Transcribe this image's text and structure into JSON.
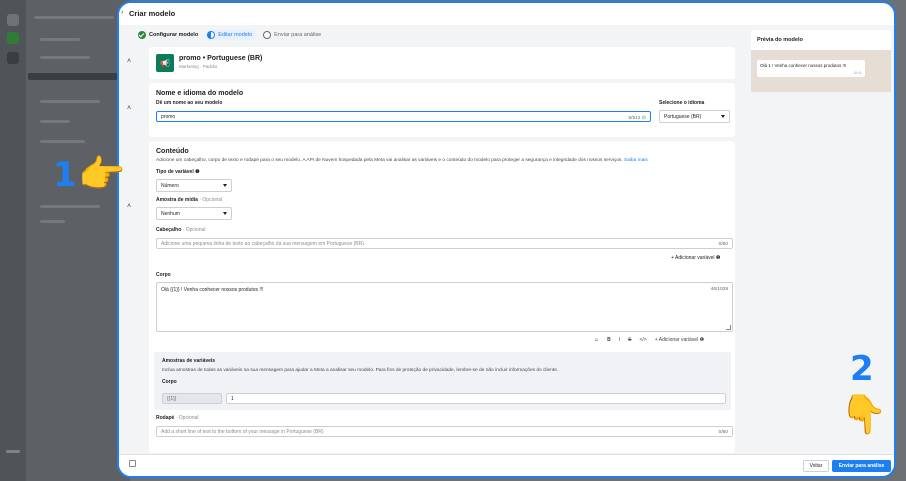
{
  "header": {
    "back_glyph": "›",
    "title": "Criar modelo"
  },
  "steps": [
    {
      "label": "Configurar modelo",
      "state": "done"
    },
    {
      "label": "Editar modelo",
      "state": "active"
    },
    {
      "label": "Enviar para análise",
      "state": "todo"
    }
  ],
  "template": {
    "icon": "megaphone-icon",
    "name": "promo • Portuguese (BR)",
    "subtitle": "Marketing · Padrão"
  },
  "name_section": {
    "title": "Nome e idioma do modelo",
    "name_label": "Dê um nome ao seu modelo",
    "name_value": "promo",
    "name_counter": "5/512",
    "lang_label": "Selecione o idioma",
    "lang_value": "Portuguese (BR)"
  },
  "content": {
    "title": "Conteúdo",
    "description": "Adicione um cabeçalho, corpo de texto e rodapé para o seu modelo. A API de Nuvem hospedada pela Meta vai analisar as variáveis e o conteúdo do modelo para proteger a segurança e integridade dos nossos serviços.",
    "learn_more": "Saiba mais",
    "var_type_label": "Tipo de variável",
    "var_type_value": "Número",
    "media_label": "Amostra de mídia",
    "optional": "· Opcional",
    "media_value": "Nenhum",
    "header_label": "Cabeçalho",
    "header_placeholder": "Adicione uma pequena linha de texto ao cabeçalho da sua mensagem em Portuguese (BR)",
    "header_counter": "0/60",
    "add_variable": "+ Adicionar variável",
    "body_label": "Corpo",
    "body_value": "Olá {{1}} ! Venha conhecer nossos produtos !!!",
    "body_counter": "46/1028",
    "toolbar": [
      "☺",
      "B",
      "I",
      "S",
      "</>"
    ],
    "samples_title": "Amostras de variáveis",
    "samples_desc": "Inclua amostras de todas as variáveis na sua mensagem para ajudar a Meta a analisar seu modelo. Para fins de proteção de privacidade, lembre-se de não incluir informações do cliente.",
    "samples_body_label": "Corpo",
    "var_tag": "{{1}}",
    "var_value": "1",
    "footer_label": "Rodapé",
    "footer_placeholder": "Add a short line of text to the bottom of your message in Portuguese (BR)",
    "footer_counter": "0/60"
  },
  "preview": {
    "title": "Prévia do modelo",
    "message": "Olá 1 ! Venha conhecer nossos produtos !!!",
    "time": "18:41"
  },
  "footer_buttons": {
    "back": "Voltar",
    "submit": "Enviar para análise"
  },
  "annotations": {
    "one": "1",
    "two": "2",
    "hand_right": "👉",
    "hand_down": "👇"
  },
  "colors": {
    "accent": "#1d7ff2",
    "success": "#2e8540",
    "template_icon": "#0a7c59"
  }
}
